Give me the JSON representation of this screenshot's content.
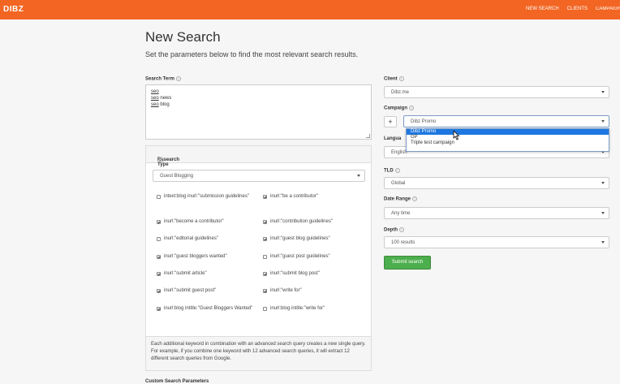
{
  "header": {
    "logo": "DIBZ",
    "nav": [
      "NEW SEARCH",
      "CLIENTS",
      "CAMPAIGNS"
    ]
  },
  "page": {
    "title": "New Search",
    "subtitle": "Set the parameters below to find the most relevant search results."
  },
  "search_term": {
    "label": "Search Term",
    "lines": [
      {
        "kw": "seo",
        "rest": ""
      },
      {
        "kw": "seo",
        "rest": " news"
      },
      {
        "kw": "seo",
        "rest": " blog"
      }
    ]
  },
  "research_type": {
    "label": "Research Type",
    "selected": "Guest Blogging",
    "checkboxes": [
      {
        "label": "intext:blog inurl:\"submission guidelines\"",
        "checked": false
      },
      {
        "label": "inurl:\"be a contributor\"",
        "checked": true
      },
      {
        "label": "inurl:\"become a contributor\"",
        "checked": true
      },
      {
        "label": "inurl:\"contribution guidelines\"",
        "checked": true
      },
      {
        "label": "inurl:\"editorial guidelines\"",
        "checked": false
      },
      {
        "label": "inurl:\"guest blog guidelines\"",
        "checked": true
      },
      {
        "label": "inurl:\"guest bloggers wanted\"",
        "checked": true
      },
      {
        "label": "inurl:\"guest post guidelines\"",
        "checked": false
      },
      {
        "label": "inurl:\"submit article\"",
        "checked": true
      },
      {
        "label": "inurl:\"submit blog post\"",
        "checked": true
      },
      {
        "label": "inurl:\"submit guest post\"",
        "checked": true
      },
      {
        "label": "inurl:\"write for\"",
        "checked": true
      },
      {
        "label": "inurl:blog intitle:\"Guest Bloggers Wanted\"",
        "checked": true
      },
      {
        "label": "inurl:blog intitle:\"write for\"",
        "checked": false
      }
    ],
    "note": "Each additional keyword in combination with an advanced search query creates a new single query. For example, if you combine one keyword with 12 advanced search queries, it will extract 12 different search queries from Google."
  },
  "custom_params_label": "Custom Search Parameters",
  "client": {
    "label": "Client",
    "selected": "Dibz.me"
  },
  "campaign": {
    "label": "Campaign",
    "plus": "+",
    "selected": "Dibz Promo",
    "options": [
      "Dibz Promo",
      "GP",
      "Triple test campaign"
    ]
  },
  "language": {
    "label": "Langua",
    "selected": "English"
  },
  "tld": {
    "label": "TLD",
    "selected": "Global"
  },
  "date_range": {
    "label": "Date Range",
    "selected": "Any time"
  },
  "depth": {
    "label": "Depth",
    "selected": "100 results"
  },
  "submit_label": "Submit search",
  "colors": {
    "brand": "#f26522",
    "submit": "#4cae4c",
    "highlight": "#1e77e0"
  }
}
